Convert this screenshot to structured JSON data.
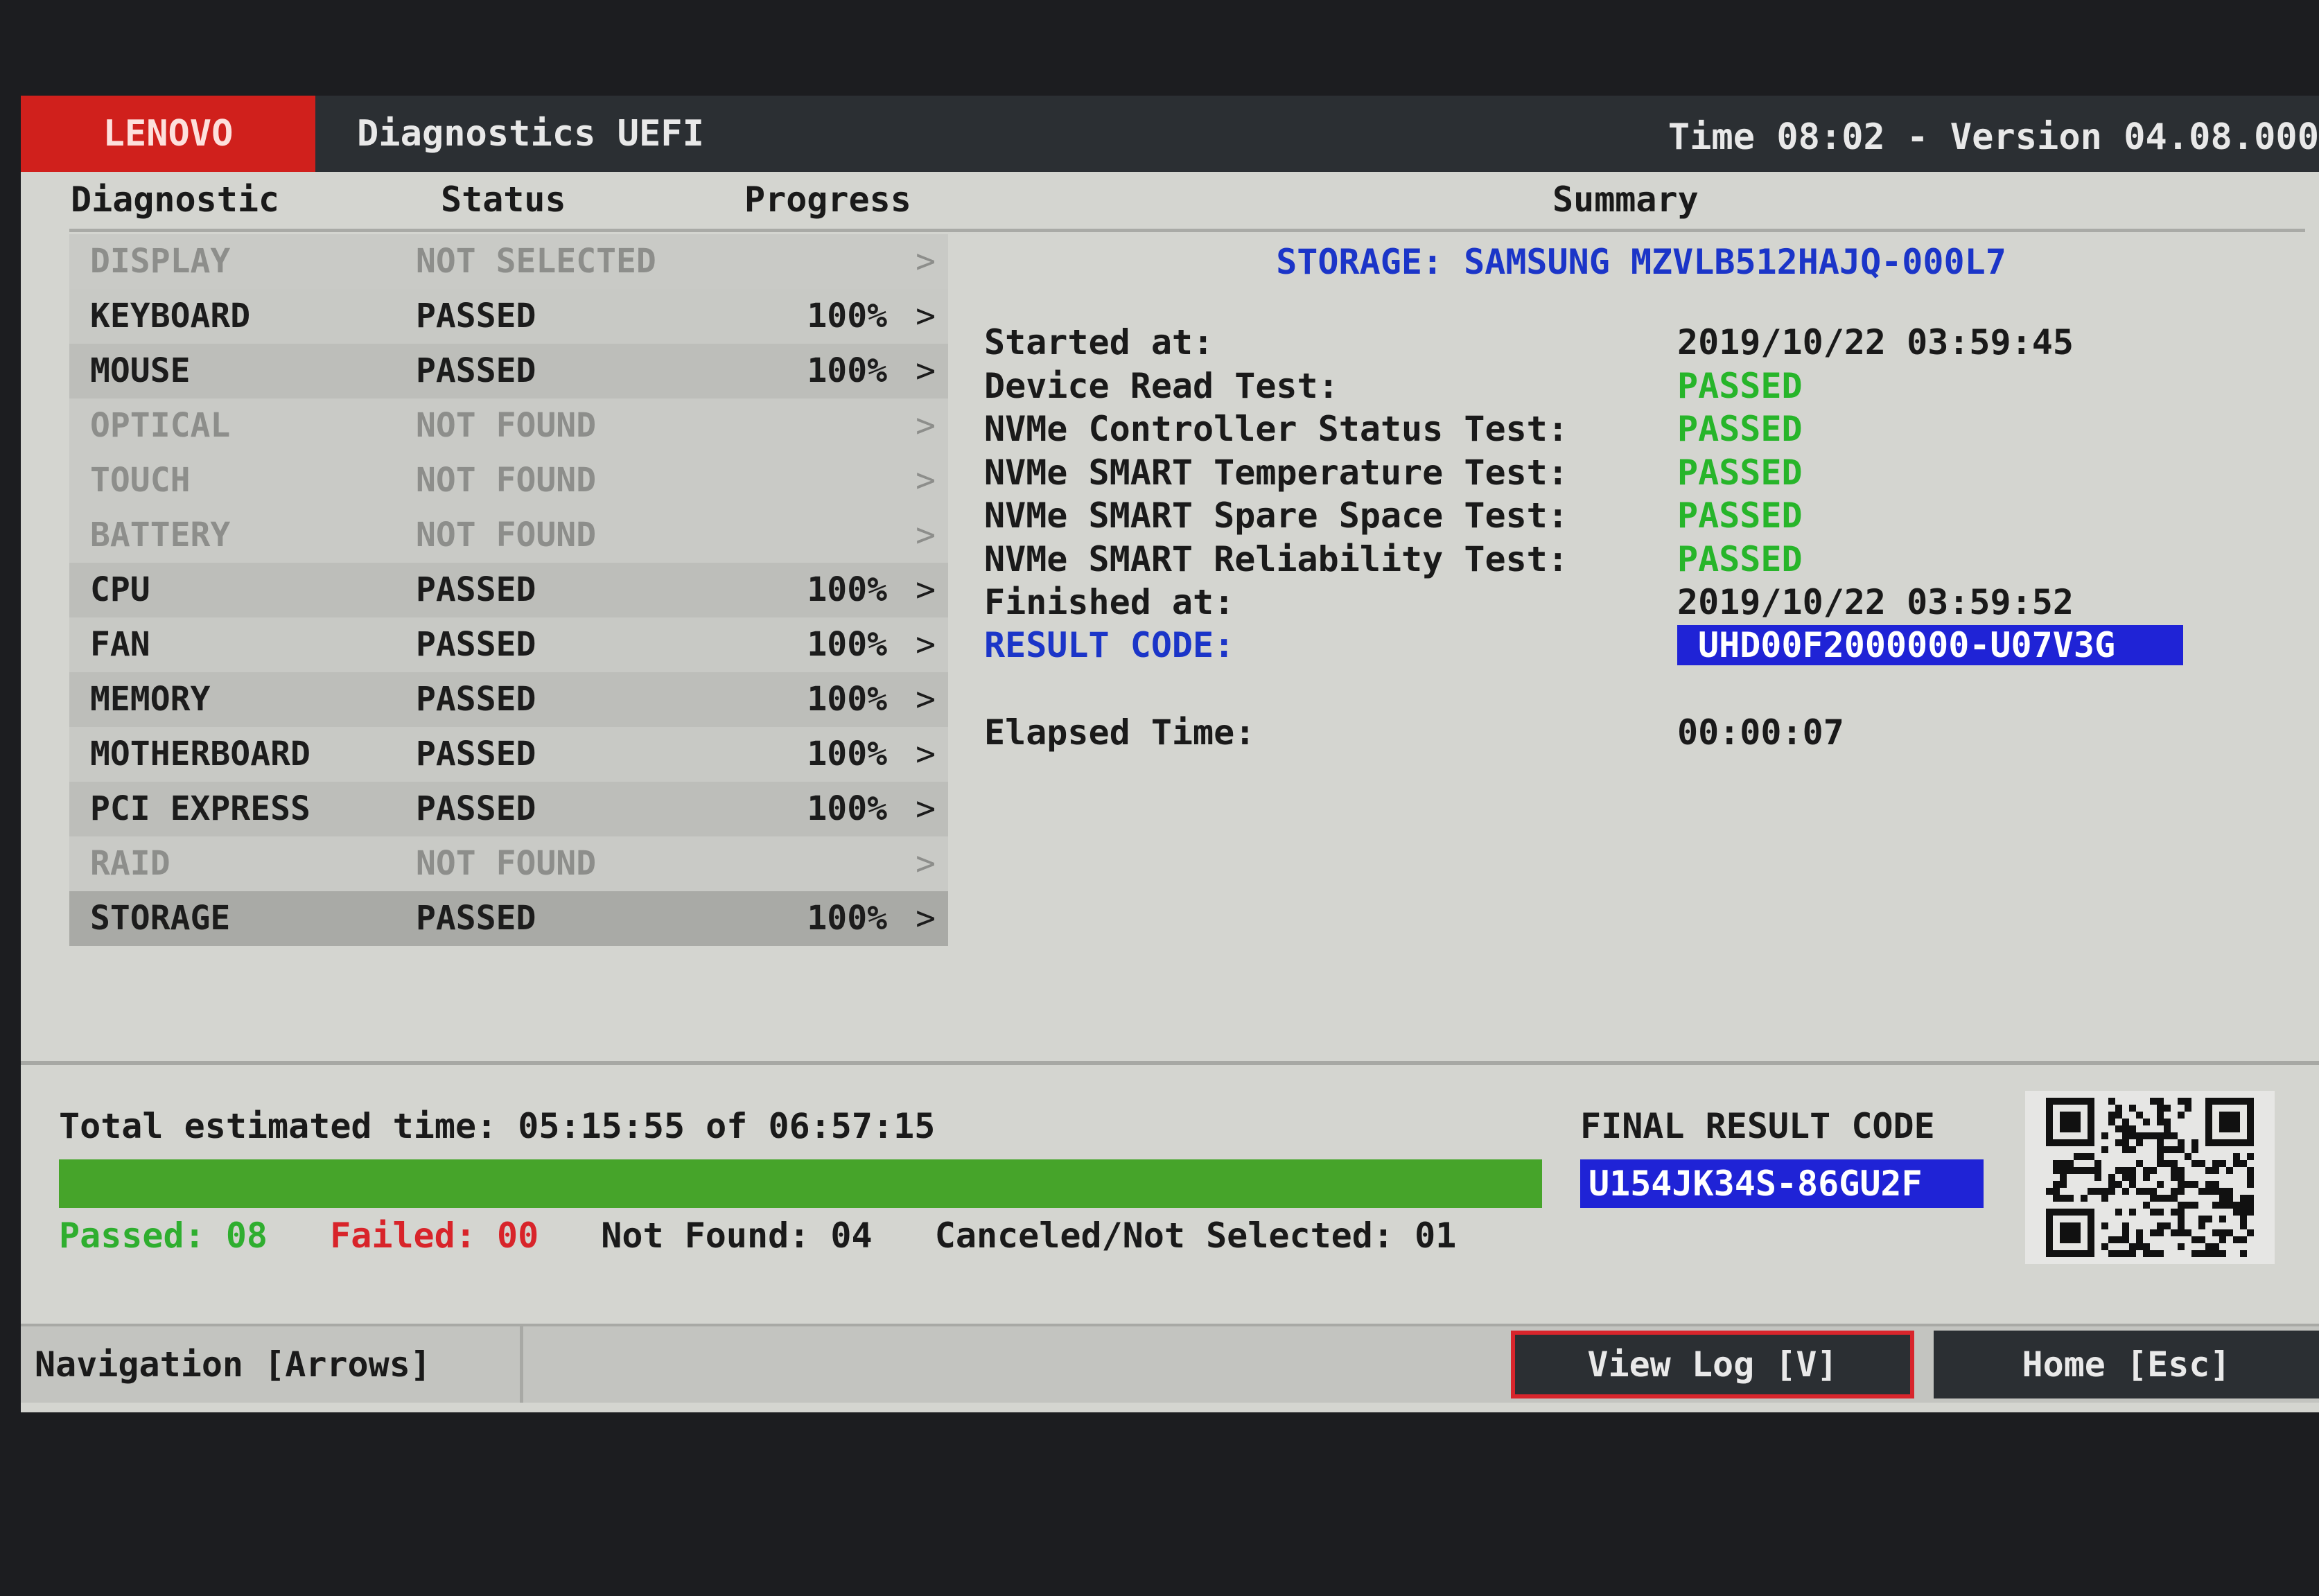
{
  "header": {
    "brand": "LENOVO",
    "title": "Diagnostics UEFI",
    "time_version": "Time 08:02 - Version 04.08.000"
  },
  "columns": {
    "diagnostic": "Diagnostic",
    "status": "Status",
    "progress": "Progress",
    "summary": "Summary"
  },
  "diagnostics": [
    {
      "name": "DISPLAY",
      "status": "NOT SELECTED",
      "progress": "",
      "arrow": ">"
    },
    {
      "name": "KEYBOARD",
      "status": "PASSED",
      "progress": "100%",
      "arrow": ">"
    },
    {
      "name": "MOUSE",
      "status": "PASSED",
      "progress": "100%",
      "arrow": ">"
    },
    {
      "name": "OPTICAL",
      "status": "NOT FOUND",
      "progress": "",
      "arrow": ">"
    },
    {
      "name": "TOUCH",
      "status": "NOT FOUND",
      "progress": "",
      "arrow": ">"
    },
    {
      "name": "BATTERY",
      "status": "NOT FOUND",
      "progress": "",
      "arrow": ">"
    },
    {
      "name": "CPU",
      "status": "PASSED",
      "progress": "100%",
      "arrow": ">"
    },
    {
      "name": "FAN",
      "status": "PASSED",
      "progress": "100%",
      "arrow": ">"
    },
    {
      "name": "MEMORY",
      "status": "PASSED",
      "progress": "100%",
      "arrow": ">"
    },
    {
      "name": "MOTHERBOARD",
      "status": "PASSED",
      "progress": "100%",
      "arrow": ">"
    },
    {
      "name": "PCI EXPRESS",
      "status": "PASSED",
      "progress": "100%",
      "arrow": ">"
    },
    {
      "name": "RAID",
      "status": "NOT FOUND",
      "progress": "",
      "arrow": ">"
    },
    {
      "name": "STORAGE",
      "status": "PASSED",
      "progress": "100%",
      "arrow": ">"
    }
  ],
  "summary": {
    "device": "STORAGE: SAMSUNG MZVLB512HAJQ-000L7",
    "started_label": "Started at:",
    "started_value": "2019/10/22 03:59:45",
    "tests": [
      {
        "label": "Device Read Test:",
        "value": "PASSED"
      },
      {
        "label": "NVMe Controller Status Test:",
        "value": "PASSED"
      },
      {
        "label": "NVMe SMART Temperature Test:",
        "value": "PASSED"
      },
      {
        "label": "NVMe SMART Spare Space Test:",
        "value": "PASSED"
      },
      {
        "label": "NVMe SMART Reliability Test:",
        "value": "PASSED"
      }
    ],
    "finished_label": "Finished at:",
    "finished_value": "2019/10/22 03:59:52",
    "result_code_label": "RESULT CODE:",
    "result_code_value": "UHD00F2000000-U07V3G",
    "elapsed_label": "Elapsed Time:",
    "elapsed_value": "00:00:07"
  },
  "totals": {
    "estimated_time": "Total estimated time: 05:15:55 of 06:57:15",
    "progress_fraction": 1.0,
    "passed": "Passed: 08",
    "failed": "Failed: 00",
    "not_found": "Not Found: 04",
    "canceled": "Canceled/Not Selected: 01"
  },
  "final_result": {
    "label": "FINAL RESULT CODE",
    "code": "U154JK34S-86GU2F"
  },
  "footer": {
    "navigation": "Navigation [Arrows]",
    "view_log": "View Log [V]",
    "home": "Home [Esc]"
  },
  "colors": {
    "brand_red": "#d0201c",
    "passed_green": "#27b52a",
    "failed_red": "#d8242a",
    "code_blue": "#1f23d6",
    "summary_blue": "#1b35c8",
    "progress_green": "#46a42a"
  }
}
